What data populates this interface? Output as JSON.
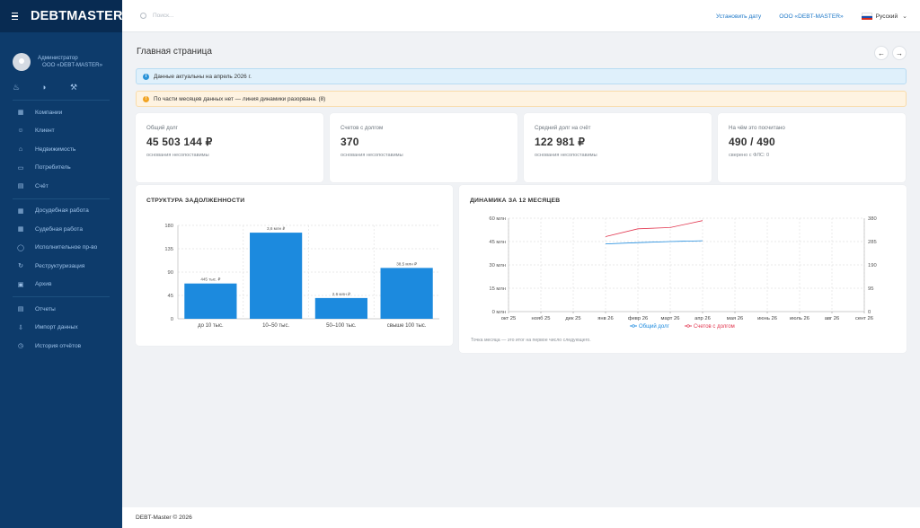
{
  "brand": "DEBTMASTER",
  "user": {
    "name": "Администратор",
    "org": "ООО «DEBT-MASTER»",
    "avatar_icon": "user-icon"
  },
  "quick_icons": [
    "bell-icon",
    "contrast-icon",
    "wrench-icon"
  ],
  "sidebar": {
    "group1": [
      {
        "label": "Компании",
        "icon": "company-icon"
      },
      {
        "label": "Клиент",
        "icon": "user-icon"
      },
      {
        "label": "Недвижимость",
        "icon": "home-icon"
      },
      {
        "label": "Потребитель",
        "icon": "card-icon"
      },
      {
        "label": "Счёт",
        "icon": "document-icon"
      }
    ],
    "group2": [
      {
        "label": "Досудебная работа",
        "icon": "calendar-icon"
      },
      {
        "label": "Судебная работа",
        "icon": "calendar-icon"
      },
      {
        "label": "Исполнительное пр-во",
        "icon": "circle-icon"
      },
      {
        "label": "Реструктуризация",
        "icon": "refresh-icon"
      },
      {
        "label": "Архив",
        "icon": "archive-icon"
      }
    ],
    "group3": [
      {
        "label": "Отчеты",
        "icon": "report-icon"
      },
      {
        "label": "Импорт данных",
        "icon": "import-icon"
      },
      {
        "label": "История отчётов",
        "icon": "history-icon"
      }
    ]
  },
  "topbar": {
    "search_placeholder": "Поиск...",
    "set_date": "Установить дату",
    "org": "ООО «DEBT-MASTER»",
    "language": "Русский"
  },
  "page": {
    "title": "Главная страница",
    "info_alert": "Данные актуальны на апрель 2026 г.",
    "warn_alert": "По части месяцев данных нет — линия динамики разорвана. (8)"
  },
  "stats": [
    {
      "label": "Общий долг",
      "value": "45 503 144 ₽",
      "sub": "основания несопоставимы"
    },
    {
      "label": "Счетов с долгом",
      "value": "370",
      "sub": "основания несопоставимы"
    },
    {
      "label": "Средний долг на счёт",
      "value": "122 981 ₽",
      "sub": "основания несопоставимы"
    },
    {
      "label": "На чём это посчитано",
      "value": "490 / 490",
      "sub": "сверено с ФЛС: 0"
    }
  ],
  "chart_data": [
    {
      "type": "bar",
      "title": "СТРУКТУРА ЗАДОЛЖЕННОСТИ",
      "categories": [
        "до 10 тыс.",
        "10–50 тыс.",
        "50–100 тыс.",
        "свыше 100 тыс."
      ],
      "values": [
        68,
        166,
        40,
        98
      ],
      "data_labels": [
        "445 тыс. ₽",
        "3,6 млн ₽",
        "2,6 млн ₽",
        "38,5 млн ₽"
      ],
      "y_ticks": [
        0,
        45,
        90,
        135,
        180
      ],
      "ylim": [
        0,
        180
      ],
      "color": "#1c8ade",
      "grid": true
    },
    {
      "type": "line",
      "title": "ДИНАМИКА ЗА 12 МЕСЯЦЕВ",
      "x": [
        "окт 25",
        "нояб 25",
        "дек 25",
        "янв 26",
        "февр 26",
        "март 26",
        "апр 26",
        "мая 26",
        "июнь 26",
        "июль 26",
        "авг 26",
        "сент 26"
      ],
      "y_left_ticks": [
        "0 млн",
        "15 млн",
        "30 млн",
        "45 млн",
        "60 млн"
      ],
      "y_right_ticks": [
        "0",
        "95",
        "190",
        "285",
        "380"
      ],
      "ylim_left": [
        0,
        60
      ],
      "ylim_right": [
        0,
        380
      ],
      "series": [
        {
          "name": "Общий долг",
          "axis": "left",
          "color": "#1c8ade",
          "values": [
            null,
            null,
            null,
            43.5,
            44.3,
            45.0,
            45.5,
            null,
            null,
            null,
            null,
            null
          ]
        },
        {
          "name": "Счетов с долгом",
          "axis": "right",
          "color": "#e2364f",
          "values": [
            null,
            null,
            null,
            305,
            337,
            342,
            370,
            null,
            null,
            null,
            null,
            null
          ]
        }
      ],
      "legend": "bottom",
      "grid": true,
      "note": "Точка месяца — это итог на первое число следующего."
    }
  ],
  "footer": "DEBT-Master © 2026"
}
